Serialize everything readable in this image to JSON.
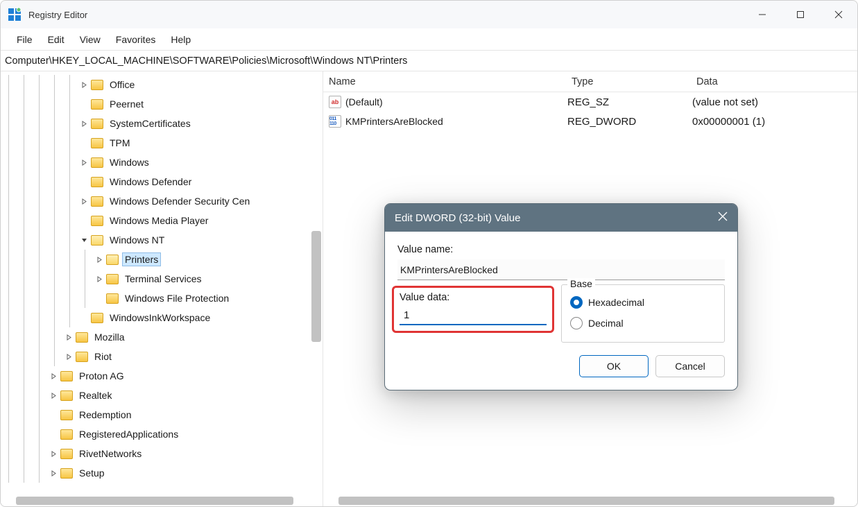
{
  "window": {
    "title": "Registry Editor"
  },
  "menu": [
    "File",
    "Edit",
    "View",
    "Favorites",
    "Help"
  ],
  "path": "Computer\\HKEY_LOCAL_MACHINE\\SOFTWARE\\Policies\\Microsoft\\Windows NT\\Printers",
  "tree": [
    {
      "indent": 5,
      "exp": ">",
      "label": "Office"
    },
    {
      "indent": 5,
      "exp": "",
      "label": "Peernet"
    },
    {
      "indent": 5,
      "exp": ">",
      "label": "SystemCertificates"
    },
    {
      "indent": 5,
      "exp": "",
      "label": "TPM"
    },
    {
      "indent": 5,
      "exp": ">",
      "label": "Windows"
    },
    {
      "indent": 5,
      "exp": "",
      "label": "Windows Defender"
    },
    {
      "indent": 5,
      "exp": ">",
      "label": "Windows Defender Security Cen"
    },
    {
      "indent": 5,
      "exp": "",
      "label": "Windows Media Player"
    },
    {
      "indent": 5,
      "exp": "v",
      "label": "Windows NT",
      "open": true
    },
    {
      "indent": 6,
      "exp": ">",
      "label": "Printers",
      "sel": true,
      "open": true
    },
    {
      "indent": 6,
      "exp": ">",
      "label": "Terminal Services"
    },
    {
      "indent": 6,
      "exp": "",
      "label": "Windows File Protection"
    },
    {
      "indent": 5,
      "exp": "",
      "label": "WindowsInkWorkspace"
    },
    {
      "indent": 4,
      "exp": ">",
      "label": "Mozilla"
    },
    {
      "indent": 4,
      "exp": ">",
      "label": "Riot"
    },
    {
      "indent": 3,
      "exp": ">",
      "label": "Proton AG"
    },
    {
      "indent": 3,
      "exp": ">",
      "label": "Realtek"
    },
    {
      "indent": 3,
      "exp": "",
      "label": "Redemption"
    },
    {
      "indent": 3,
      "exp": "",
      "label": "RegisteredApplications"
    },
    {
      "indent": 3,
      "exp": ">",
      "label": "RivetNetworks"
    },
    {
      "indent": 3,
      "exp": ">",
      "label": "Setup"
    }
  ],
  "list": {
    "cols": {
      "name": "Name",
      "type": "Type",
      "data": "Data"
    },
    "rows": [
      {
        "icon": "ab",
        "name": "(Default)",
        "type": "REG_SZ",
        "data": "(value not set)"
      },
      {
        "icon": "bin",
        "name": "KMPrintersAreBlocked",
        "type": "REG_DWORD",
        "data": "0x00000001 (1)"
      }
    ]
  },
  "dialog": {
    "title": "Edit DWORD (32-bit) Value",
    "value_name_label": "Value name:",
    "value_name": "KMPrintersAreBlocked",
    "value_data_label": "Value data:",
    "value_data": "1",
    "base_label": "Base",
    "hex_label": "Hexadecimal",
    "dec_label": "Decimal",
    "ok": "OK",
    "cancel": "Cancel"
  }
}
